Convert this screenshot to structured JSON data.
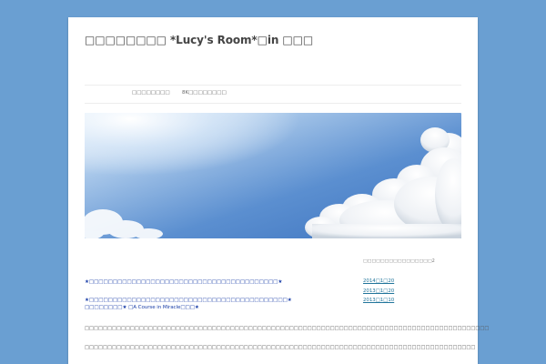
{
  "site": {
    "title": "□□□□□□□□ *Lucy's Room*□in □□□"
  },
  "nav": {
    "items": [
      {
        "label": "□□□□□□□□"
      },
      {
        "label": "8K□□□□□□□□"
      }
    ]
  },
  "header_image": {
    "sky_top": "#3d78c2",
    "sky_bottom": "#cfe2f4",
    "cloud": "#ffffff"
  },
  "content": {
    "link1": "★□□□□□□□□□□□□□□□□□□□□□□□□□□□□□□□□□□□□□□□□★",
    "link2": "★□□□□□□□□□□□□□□□□□□□□□□□□□□□□□□□□□□□□□□□□□□★",
    "link3": "□□□□□□□□★ □A Course in Miracle□□□★",
    "para1": "□□□□□□□□□□□□□□□□□□□□□□□□□□□□□□□□□□□□□□□□□□□□□□□□□□□□□□□□□□□□□□□□□□□□□□□□□□□□□□□□□□□□□□□□□",
    "para2": "□□□□□□□□□□□□□□□□□□□□□□□□□□□□□□□□□□□□□□□□□□□□□□□□□□□□□□□□□□□□□□□□□□□□□□□□□□□□□□□□□□□□□□"
  },
  "sidebar": {
    "widget_title": "□□□□□□□□□□□□□□□□2",
    "archives": [
      {
        "label": "2014□1□20"
      },
      {
        "label": "2013□1□20"
      },
      {
        "label": "2013□1□10"
      }
    ]
  }
}
